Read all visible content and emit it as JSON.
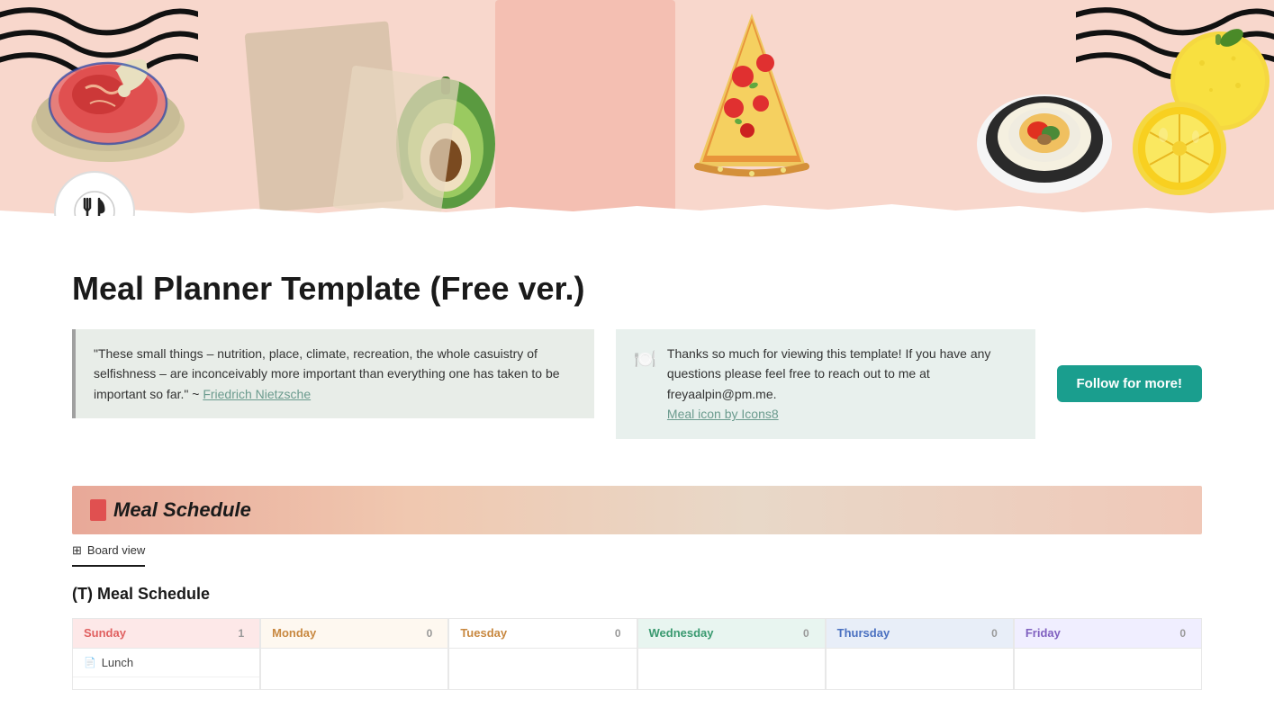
{
  "header": {
    "logo_icon": "🍽️",
    "banner_alt": "Food themed decorative banner"
  },
  "page": {
    "title": "Meal Planner Template (Free ver.)"
  },
  "quote_card": {
    "text": "\"These small things – nutrition, place, climate, recreation, the whole casuistry of selfishness – are inconceivably more important than everything one has taken to be important so far.\" ~ ",
    "author": "Friedrich Nietzsche",
    "author_link": "#"
  },
  "info_card": {
    "text": "Thanks so much for viewing this template! If you have any questions please feel free to reach out to me at freyaalpin@pm.me.",
    "link_text": "Meal icon by Icons8",
    "link_href": "#"
  },
  "follow_button": {
    "label": "Follow for more!"
  },
  "meal_schedule_section": {
    "title": "Meal Schedule",
    "view_label": "Board view",
    "subtitle": "(T) Meal Schedule"
  },
  "board": {
    "columns": [
      {
        "day": "Sunday",
        "count": 1,
        "color_class": "col-sunday",
        "cards": [
          {
            "name": "Lunch"
          }
        ]
      },
      {
        "day": "Monday",
        "count": 0,
        "color_class": "col-monday",
        "cards": []
      },
      {
        "day": "Tuesday",
        "count": 0,
        "color_class": "col-tuesday",
        "cards": []
      },
      {
        "day": "Wednesday",
        "count": 0,
        "color_class": "col-wednesday",
        "cards": []
      },
      {
        "day": "Thursday",
        "count": 0,
        "color_class": "col-thursday",
        "cards": []
      },
      {
        "day": "Friday",
        "count": 0,
        "color_class": "col-friday",
        "cards": []
      }
    ]
  }
}
